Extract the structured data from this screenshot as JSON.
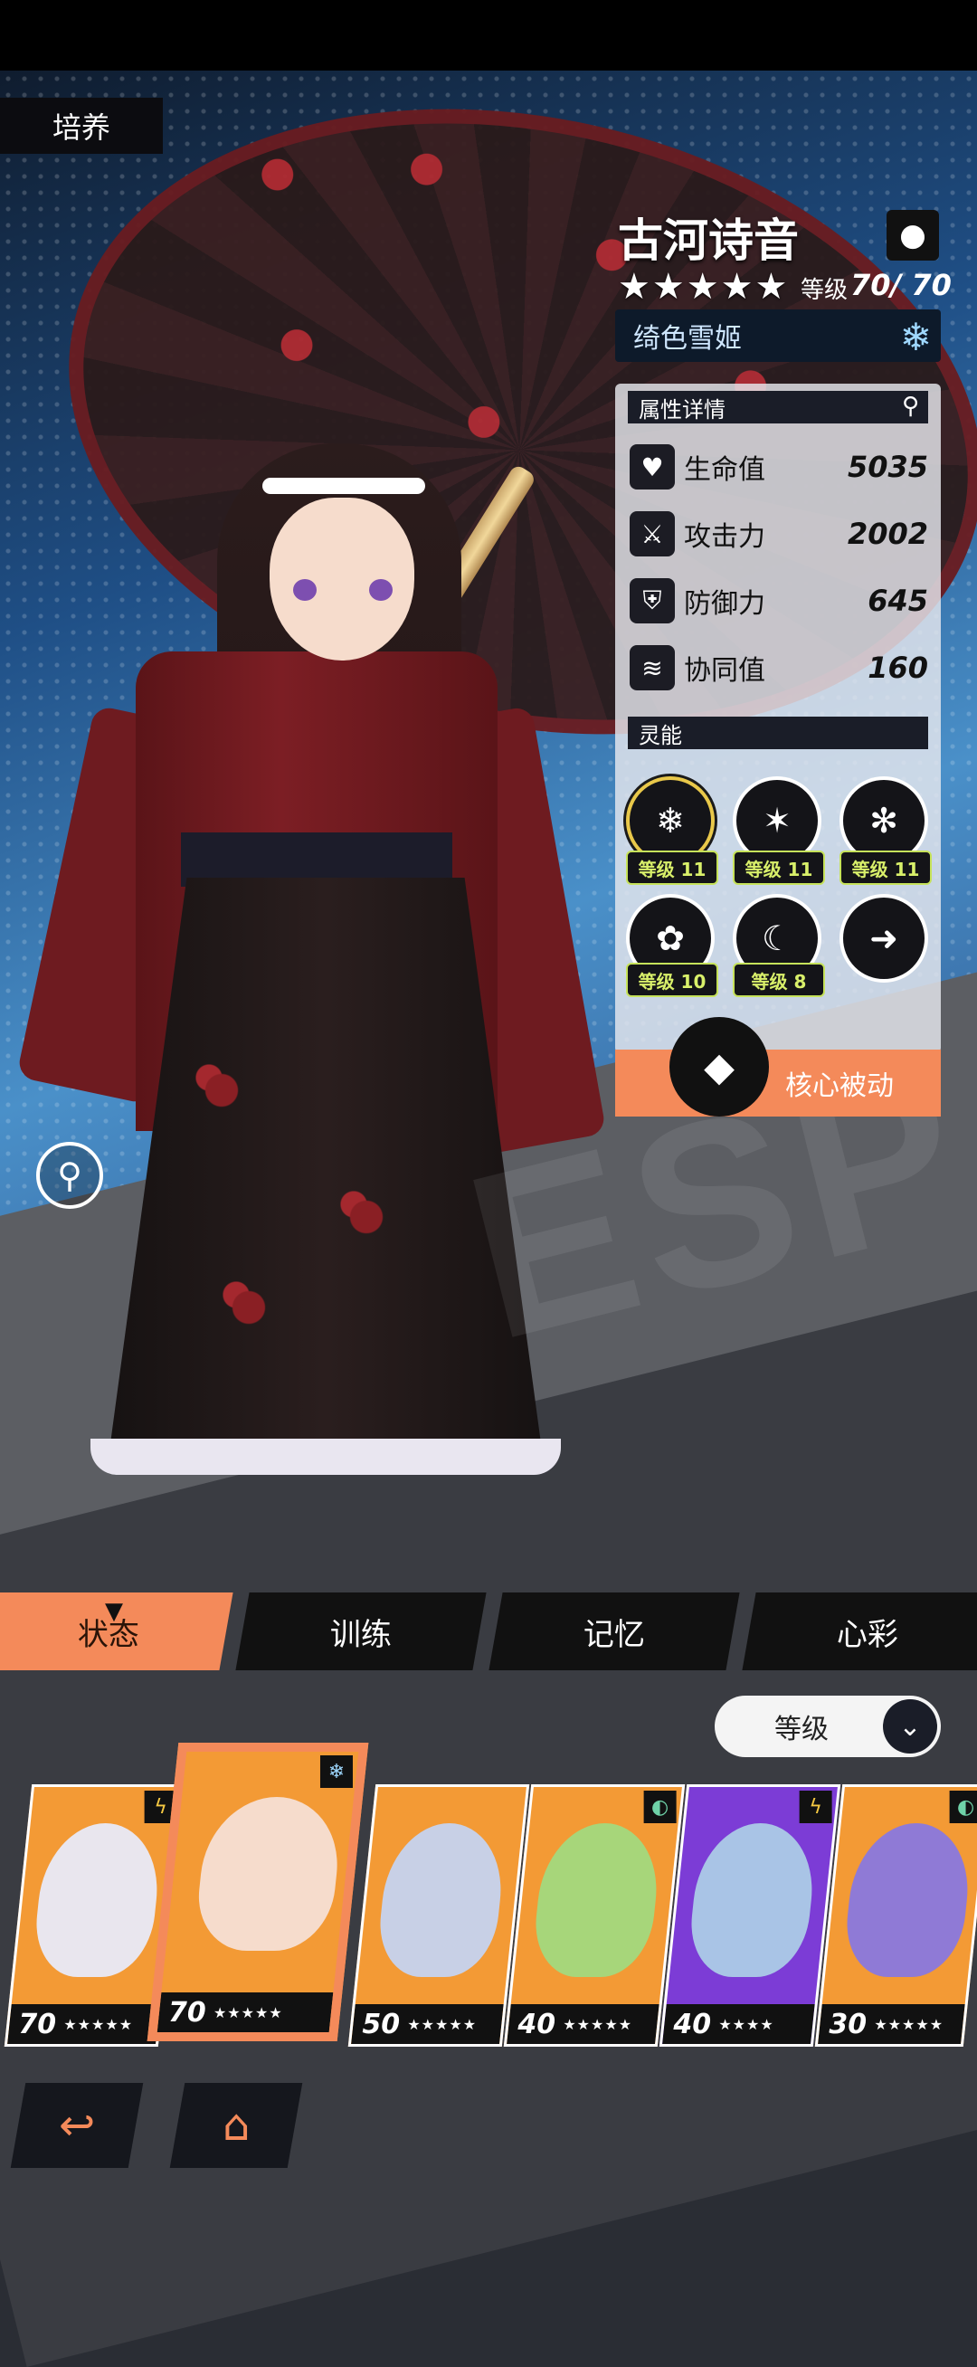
{
  "header": {
    "section_tag": "培养"
  },
  "character": {
    "name": "古河诗音",
    "stars": "★★★★★",
    "level_label": "等级",
    "level_value": "70/ 70",
    "title": "绮色雪姬",
    "element_icon": "snowflake-icon",
    "type_icon": "bomb-icon"
  },
  "stats": {
    "header": "属性详情",
    "rows": [
      {
        "label": "生命值",
        "value": "5035",
        "icon": "heart-pulse-icon"
      },
      {
        "label": "攻击力",
        "value": "2002",
        "icon": "sword-icon"
      },
      {
        "label": "防御力",
        "value": "645",
        "icon": "shield-icon"
      },
      {
        "label": "协同值",
        "value": "160",
        "icon": "wave-icon"
      }
    ]
  },
  "psi": {
    "header": "灵能",
    "skills": [
      {
        "level": "等级 11",
        "icon": "snow-tree-icon"
      },
      {
        "level": "等级 11",
        "icon": "ice-claw-icon"
      },
      {
        "level": "等级 11",
        "icon": "snow-slash-icon"
      },
      {
        "level": "等级 10",
        "icon": "rose-swirl-icon"
      },
      {
        "level": "等级 8",
        "icon": "moon-face-icon"
      },
      {
        "level": "",
        "icon": "dash-figure-icon"
      }
    ],
    "core_passive": "核心被动"
  },
  "tabs": [
    {
      "label": "状态",
      "active": true
    },
    {
      "label": "训练",
      "active": false
    },
    {
      "label": "记忆",
      "active": false
    },
    {
      "label": "心彩",
      "active": false
    }
  ],
  "sort": {
    "label": "等级"
  },
  "roster": [
    {
      "level": "70",
      "stars": "★★★★★",
      "element": "lightning-icon",
      "color": "#f39a35"
    },
    {
      "level": "70",
      "stars": "★★★★★",
      "element": "snowflake-icon",
      "color": "#f39a35",
      "selected": true
    },
    {
      "level": "50",
      "stars": "★★★★★",
      "element": "",
      "color": "#f39a35"
    },
    {
      "level": "40",
      "stars": "★★★★★",
      "element": "wind-icon",
      "color": "#f39a35"
    },
    {
      "level": "40",
      "stars": "★★★★",
      "element": "lightning-icon",
      "color": "#7c3cd6"
    },
    {
      "level": "30",
      "stars": "★★★★★",
      "element": "wind-icon",
      "color": "#f39a35"
    }
  ],
  "colors": {
    "accent": "#f48a5a",
    "panel_dark": "#1a1d28",
    "skill_level": "#d9f06a"
  }
}
